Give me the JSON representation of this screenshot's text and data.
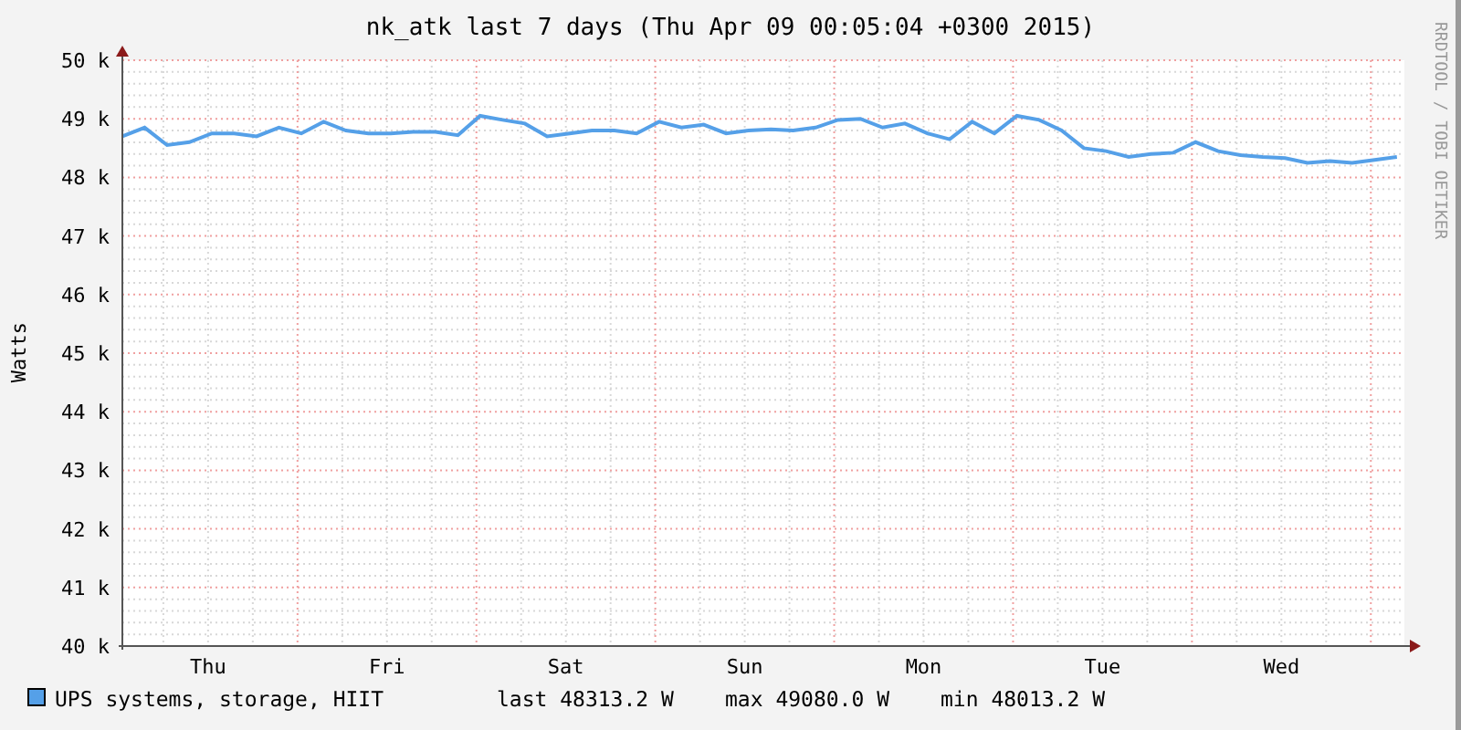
{
  "title": "nk_atk last 7 days (Thu Apr 09 00:05:04 +0300 2015)",
  "credit": "RRDTOOL / TOBI OETIKER",
  "chart_data": {
    "type": "line",
    "grid": true,
    "ylabel": "Watts",
    "ylim": [
      40000,
      50000
    ],
    "yticks": [
      {
        "value": 40000,
        "label": "40 k"
      },
      {
        "value": 41000,
        "label": "41 k"
      },
      {
        "value": 42000,
        "label": "42 k"
      },
      {
        "value": 43000,
        "label": "43 k"
      },
      {
        "value": 44000,
        "label": "44 k"
      },
      {
        "value": 45000,
        "label": "45 k"
      },
      {
        "value": 46000,
        "label": "46 k"
      },
      {
        "value": 47000,
        "label": "47 k"
      },
      {
        "value": 48000,
        "label": "48 k"
      },
      {
        "value": 49000,
        "label": "49 k"
      },
      {
        "value": 50000,
        "label": "50 k"
      }
    ],
    "categories": [
      null,
      null,
      null,
      null,
      "Thu",
      null,
      null,
      null,
      null,
      null,
      null,
      null,
      "Fri",
      null,
      null,
      null,
      null,
      null,
      null,
      null,
      "Sat",
      null,
      null,
      null,
      null,
      null,
      null,
      null,
      "Sun",
      null,
      null,
      null,
      null,
      null,
      null,
      null,
      "Mon",
      null,
      null,
      null,
      null,
      null,
      null,
      null,
      "Tue",
      null,
      null,
      null,
      null,
      null,
      null,
      null,
      "Wed",
      null,
      null,
      null,
      null,
      null
    ],
    "series": [
      {
        "name": "UPS systems, storage, HIIT",
        "color": "#55a0e8",
        "values": [
          48700,
          48850,
          48550,
          48600,
          48750,
          48750,
          48700,
          48850,
          48750,
          48950,
          48800,
          48750,
          48750,
          48780,
          48780,
          48720,
          49050,
          48980,
          48920,
          48700,
          48750,
          48800,
          48800,
          48750,
          48950,
          48850,
          48900,
          48750,
          48800,
          48820,
          48800,
          48850,
          48980,
          49000,
          48850,
          48920,
          48750,
          48650,
          48950,
          48750,
          49050,
          48980,
          48800,
          48500,
          48450,
          48350,
          48400,
          48420,
          48600,
          48450,
          48380,
          48350,
          48330,
          48250,
          48280,
          48250,
          48300,
          48350
        ]
      }
    ]
  },
  "legend": {
    "last": "last 48313.2 W",
    "max": "max 49080.0 W",
    "min": "min 48013.2 W"
  }
}
